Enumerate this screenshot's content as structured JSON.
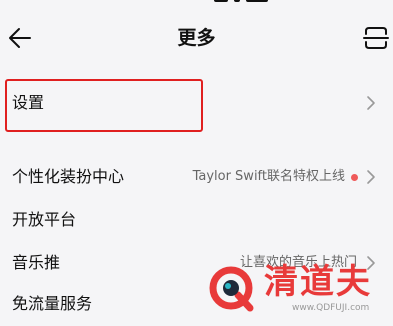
{
  "header": {
    "title": "更多",
    "back_icon": "back-arrow-icon",
    "scan_icon": "scan-icon"
  },
  "menu": {
    "items": [
      {
        "label": "设置",
        "description": "",
        "has_dot": false,
        "icon": "chevron-right-icon",
        "highlighted": true
      },
      {
        "label": "个性化装扮中心",
        "description": "Taylor Swift联名特权上线",
        "has_dot": true,
        "icon": "chevron-right-icon"
      },
      {
        "label": "开放平台",
        "description": "",
        "has_dot": false
      },
      {
        "label": "音乐推",
        "description": "让喜欢的音乐上热门",
        "has_dot": false,
        "icon": "chevron-right-icon"
      },
      {
        "label": "免流量服务",
        "description": "",
        "has_dot": false
      }
    ]
  },
  "colors": {
    "background": "#f5f5f7",
    "highlight_border": "#e02020",
    "dot": "#ef5a5a"
  },
  "watermark": {
    "text": "清道夫",
    "url": "www.QDFUJI.com"
  }
}
